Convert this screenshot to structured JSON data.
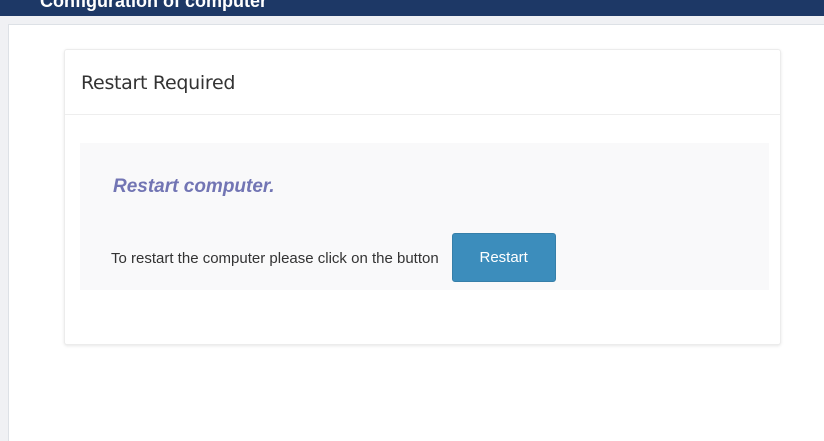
{
  "header": {
    "title": "Configuration of computer"
  },
  "panel": {
    "title": "Restart Required"
  },
  "well": {
    "heading": "Restart computer.",
    "instruction": "To restart the computer please click on the button",
    "button_label": "Restart"
  }
}
